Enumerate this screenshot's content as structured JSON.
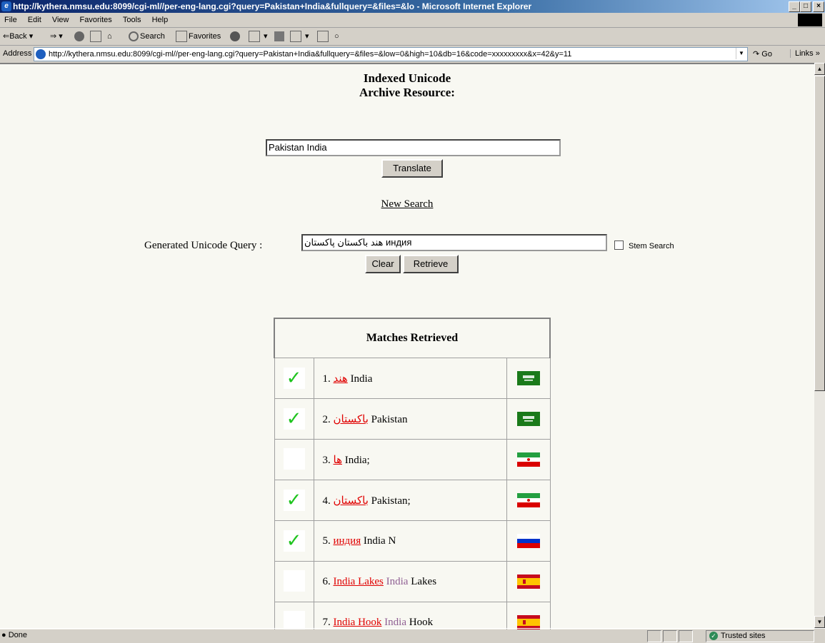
{
  "window": {
    "title": "http://kythera.nmsu.edu:8099/cgi-ml//per-eng-lang.cgi?query=Pakistan+India&fullquery=&files=&lo - Microsoft Internet Explorer",
    "min": "_",
    "max": "□",
    "close": "×"
  },
  "menu": [
    "File",
    "Edit",
    "View",
    "Favorites",
    "Tools",
    "Help"
  ],
  "toolbar": {
    "back": "Back",
    "search": "Search",
    "favorites": "Favorites"
  },
  "address": {
    "label": "Address",
    "url": "http://kythera.nmsu.edu:8099/cgi-ml//per-eng-lang.cgi?query=Pakistan+India&fullquery=&files=&low=0&high=10&db=16&code=xxxxxxxxx&x=42&y=11",
    "go": "Go",
    "links": "Links »"
  },
  "page": {
    "heading1": "Indexed Unicode",
    "heading2": "Archive Resource:",
    "query_value": "Pakistan India",
    "translate": "Translate",
    "new_search": "New Search",
    "generated_label": "Generated Unicode Query :",
    "generated_value": "индия هند باکستان پاکستان",
    "stem_label": "Stem Search",
    "clear": "Clear",
    "retrieve": "Retrieve",
    "matches_header": "Matches Retrieved"
  },
  "matches": [
    {
      "n": "1.",
      "link": "هند",
      "mid": "",
      "tail": " India",
      "checked": true,
      "flag": "saudi"
    },
    {
      "n": "2.",
      "link": "باکستان",
      "mid": "",
      "tail": " Pakistan",
      "checked": true,
      "flag": "saudi"
    },
    {
      "n": "3.",
      "link": "ها",
      "mid": "",
      "tail": " India;",
      "checked": false,
      "flag": "iran"
    },
    {
      "n": "4.",
      "link": "باکستان",
      "mid": "",
      "tail": " Pakistan;",
      "checked": true,
      "flag": "iran"
    },
    {
      "n": "5.",
      "link": "индия",
      "mid": "",
      "tail": " India N",
      "checked": true,
      "flag": "russia"
    },
    {
      "n": "6.",
      "link": "India Lakes",
      "mid": " India",
      "tail": " Lakes",
      "checked": false,
      "flag": "spain"
    },
    {
      "n": "7.",
      "link": "India Hook",
      "mid": " India",
      "tail": " Hook",
      "checked": false,
      "flag": "spain"
    }
  ],
  "status": {
    "done": "Done",
    "zone": "Trusted sites"
  }
}
